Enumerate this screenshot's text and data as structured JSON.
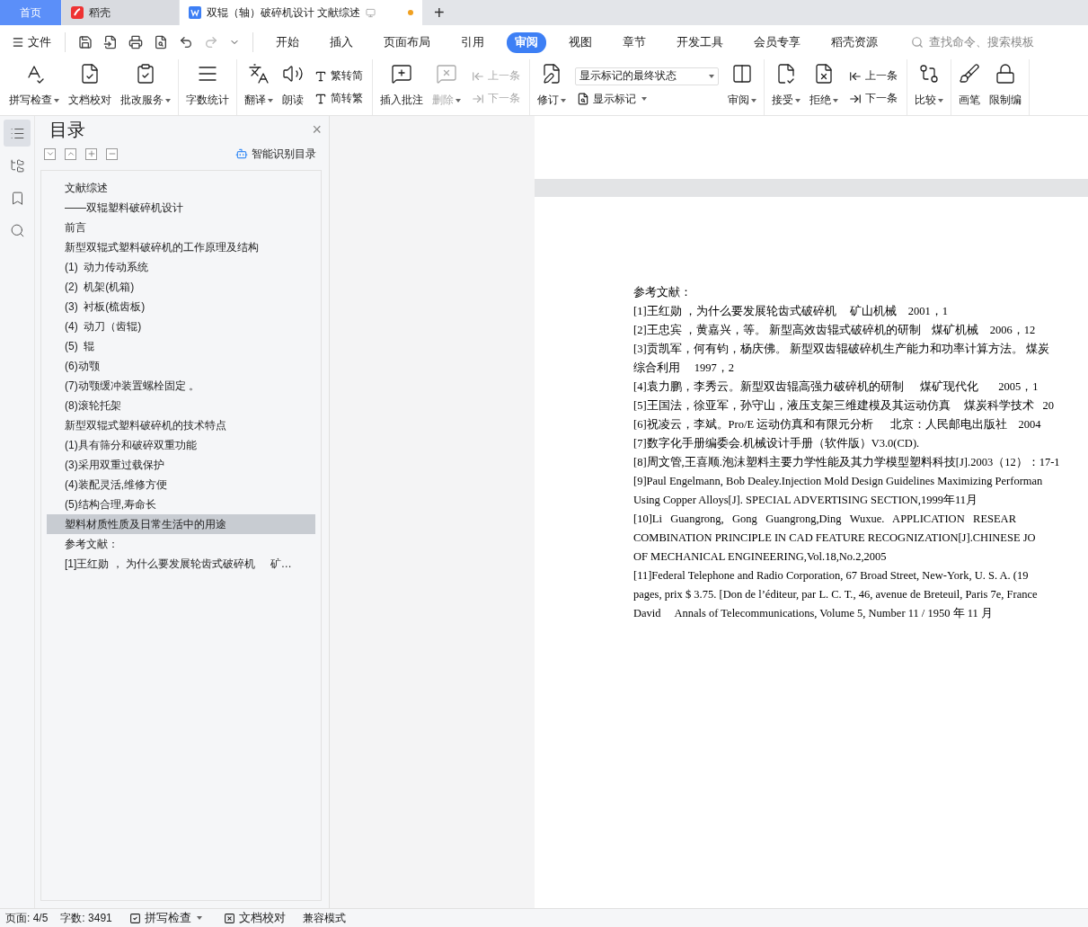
{
  "title_tabs": [
    {
      "label": "首页",
      "kind": "home",
      "selected": false
    },
    {
      "label": "稻壳",
      "kind": "app",
      "selected": false
    },
    {
      "label": "双辊（轴）破碎机设计 文献综述",
      "kind": "doc",
      "selected": true,
      "unsaved": true
    }
  ],
  "new_tab": "+",
  "file_menu": "文件",
  "quick_access": [
    {
      "disabled": false
    },
    {
      "disabled": false
    },
    {
      "disabled": false
    },
    {
      "disabled": false
    },
    {
      "disabled": false
    },
    {
      "disabled": true
    },
    {
      "disabled": false
    }
  ],
  "ribbon_tabs": [
    {
      "label": "开始",
      "selected": false
    },
    {
      "label": "插入",
      "selected": false
    },
    {
      "label": "页面布局",
      "selected": false
    },
    {
      "label": "引用",
      "selected": false
    },
    {
      "label": "审阅",
      "selected": true
    },
    {
      "label": "视图",
      "selected": false
    },
    {
      "label": "章节",
      "selected": false
    },
    {
      "label": "开发工具",
      "selected": false
    },
    {
      "label": "会员专享",
      "selected": false
    },
    {
      "label": "稻壳资源",
      "selected": false
    }
  ],
  "command_search": {
    "placeholder": "查找命令、搜索模板"
  },
  "ribbon_groups": [
    {
      "items": [
        {
          "kind": "large",
          "label": "拼写检查",
          "dropdown": true,
          "disabled": false
        },
        {
          "kind": "large",
          "label": "文档校对",
          "dropdown": false,
          "disabled": false
        },
        {
          "kind": "large",
          "label": "批改服务",
          "dropdown": true,
          "disabled": false
        }
      ]
    },
    {
      "items": [
        {
          "kind": "large",
          "label": "字数统计",
          "dropdown": false,
          "disabled": false
        }
      ]
    },
    {
      "items": [
        {
          "kind": "large",
          "label": "翻译",
          "dropdown": true,
          "disabled": false
        },
        {
          "kind": "large",
          "label": "朗读",
          "dropdown": false,
          "disabled": false
        },
        {
          "kind": "stack",
          "rows": [
            {
              "kind": "button",
              "label": "繁转简",
              "dropdown": false,
              "disabled": false
            },
            {
              "kind": "button",
              "label": "简转繁",
              "dropdown": false,
              "disabled": false
            }
          ]
        }
      ]
    },
    {
      "items": [
        {
          "kind": "large",
          "label": "插入批注",
          "dropdown": false,
          "disabled": false
        },
        {
          "kind": "large",
          "label": "删除",
          "dropdown": true,
          "disabled": true
        },
        {
          "kind": "stack",
          "rows": [
            {
              "kind": "button",
              "label": "上一条",
              "dropdown": false,
              "disabled": true
            },
            {
              "kind": "button",
              "label": "下一条",
              "dropdown": false,
              "disabled": true
            }
          ]
        }
      ]
    },
    {
      "items": [
        {
          "kind": "large",
          "label": "修订",
          "dropdown": true,
          "disabled": false
        },
        {
          "kind": "stack",
          "rows": [
            {
              "kind": "select",
              "value": "显示标记的最终状态"
            },
            {
              "kind": "button",
              "label": "显示标记",
              "dropdown": true,
              "disabled": false
            }
          ]
        },
        {
          "kind": "large",
          "label": "审阅",
          "dropdown": true,
          "disabled": false
        }
      ]
    },
    {
      "items": [
        {
          "kind": "large",
          "label": "接受",
          "dropdown": true,
          "disabled": false
        },
        {
          "kind": "large",
          "label": "拒绝",
          "dropdown": true,
          "disabled": false
        },
        {
          "kind": "stack",
          "rows": [
            {
              "kind": "button",
              "label": "上一条",
              "dropdown": false,
              "disabled": false
            },
            {
              "kind": "button",
              "label": "下一条",
              "dropdown": false,
              "disabled": false
            }
          ]
        }
      ]
    },
    {
      "items": [
        {
          "kind": "large",
          "label": "比较",
          "dropdown": true,
          "disabled": false
        }
      ]
    },
    {
      "items": [
        {
          "kind": "large",
          "label": "画笔",
          "dropdown": false,
          "disabled": false
        },
        {
          "kind": "large",
          "label": "限制编",
          "dropdown": false,
          "disabled": false
        }
      ]
    }
  ],
  "side_rail": [
    {
      "selected": true
    },
    {
      "selected": false
    },
    {
      "selected": false
    },
    {
      "selected": false
    }
  ],
  "toc_panel": {
    "title": "目录",
    "close": "×",
    "smart_button": "智能识别目录",
    "items": [
      {
        "label": "文献综述",
        "selected": false
      },
      {
        "label": "——双辊塑料破碎机设计",
        "selected": false
      },
      {
        "label": "前言",
        "selected": false
      },
      {
        "label": "新型双辊式塑料破碎机的工作原理及结构",
        "selected": false
      },
      {
        "label": "(1)  动力传动系统",
        "selected": false
      },
      {
        "label": "(2)  机架(机箱)",
        "selected": false
      },
      {
        "label": "(3)  衬板(梳齿板)",
        "selected": false
      },
      {
        "label": "(4)  动刀（齿辊)",
        "selected": false
      },
      {
        "label": "(5)  辊",
        "selected": false
      },
      {
        "label": "(6)动颚",
        "selected": false
      },
      {
        "label": "(7)动颚缓冲装置螺栓固定 。",
        "selected": false
      },
      {
        "label": "(8)滚轮托架",
        "selected": false
      },
      {
        "label": "新型双辊式塑料破碎机的技术特点",
        "selected": false
      },
      {
        "label": "(1)具有筛分和破碎双重功能",
        "selected": false
      },
      {
        "label": "(3)采用双重过载保护",
        "selected": false
      },
      {
        "label": "(4)装配灵活,维修方便",
        "selected": false
      },
      {
        "label": "(5)结构合理,寿命长",
        "selected": false
      },
      {
        "label": "塑料材质性质及日常生活中的用途",
        "selected": true
      },
      {
        "label": "参考文献：",
        "selected": false
      },
      {
        "label": "[1]王红勋 ， 为什么要发展轮齿式破碎机     矿…",
        "selected": false
      }
    ]
  },
  "document_lines": [
    "参考文献：",
    "[1]王红勋 ，为什么要发展轮齿式破碎机     矿山机械    2001，1",
    "[2]王忠宾 ，黄嘉兴，等。 新型高效齿辊式破碎机的研制    煤矿机械    2006，12",
    "[3]贡凯军，何有钧，杨庆佛。 新型双齿辊破碎机生产能力和功率计算方法。 煤炭",
    "综合利用     1997，2",
    "[4]袁力鹏，李秀云。新型双齿辊高强力破碎机的研制      煤矿现代化       2005，1",
    "[5]王国法，徐亚军，孙守山，液压支架三维建模及其运动仿真     煤炭科学技术   20",
    "[6]祝凌云，李斌。Pro/E 运动仿真和有限元分析      北京：人民邮电出版社    2004",
    "[7]数字化手册编委会.机械设计手册（软件版）V3.0(CD).",
    "[8]周文管,王喜顺.泡沫塑料主要力学性能及其力学模型塑料科技[J].2003（12）：17-1",
    "[9]Paul Engelmann, Bob Dealey.Injection Mold Design Guidelines Maximizing Performan",
    "Using Copper Alloys[J]. SPECIAL ADVERTISING SECTION,1999年11月",
    "[10]Li   Guangrong,   Gong   Guangrong,Ding   Wuxue.   APPLICATION   RESEAR",
    "COMBINATION PRINCIPLE IN CAD FEATURE RECOGNIZATION[J].CHINESE JO",
    "OF MECHANICAL ENGINEERING,Vol.18,No.2,2005",
    "[11]Federal Telephone and Radio Corporation, 67 Broad Street, New-York, U. S. A. (19",
    "pages, prix $ 3.75. [Don de l’éditeur, par L. C. T., 46, avenue de Breteuil, Paris 7e, France",
    "David     Annals of Telecommunications, Volume 5, Number 11 / 1950 年 11 月"
  ],
  "status_bar": {
    "page": "页面: 4/5",
    "words": "字数: 3491",
    "spell_check": "拼写检查",
    "proofread": "文档校对",
    "mode": "兼容模式"
  }
}
